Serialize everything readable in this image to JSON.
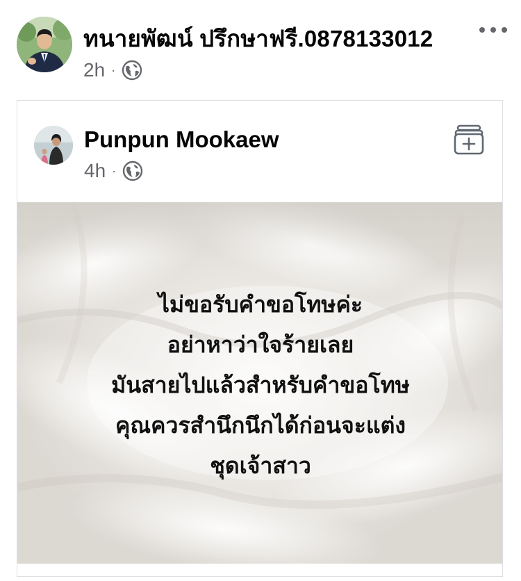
{
  "post": {
    "author": "ทนายพัฒน์ ปรึกษาฟรี.0878133012",
    "time": "2h",
    "dot": "·",
    "privacy_icon": "globe-icon",
    "more_icon": "more-options-icon"
  },
  "shared_post": {
    "author": "Punpun Mookaew",
    "time": "4h",
    "dot": "·",
    "privacy_icon": "globe-icon",
    "save_icon": "save-to-collection-icon",
    "quote_lines": [
      "ไม่ขอรับคำขอโทษค่ะ",
      "อย่าหาว่าใจร้ายเลย",
      "มันสายไปแล้วสำหรับคำขอโทษ",
      "คุณควรสำนึกนึกได้ก่อนจะแต่ง",
      "ชุดเจ้าสาว"
    ]
  },
  "colors": {
    "text": "#050505",
    "meta": "#65676b",
    "card_border": "#dcdfe3",
    "quote_text": "#111111"
  }
}
